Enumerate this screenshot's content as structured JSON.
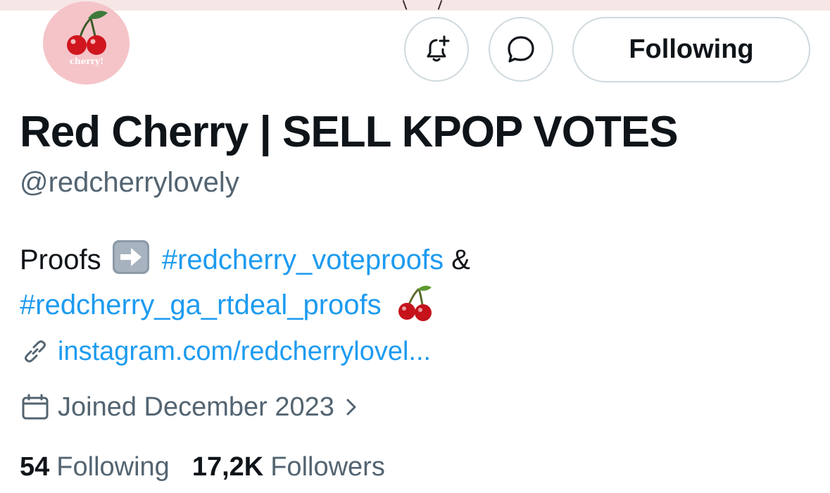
{
  "profile": {
    "display_name": "Red Cherry | SELL KPOP VOTES",
    "handle": "@redcherrylovely",
    "avatar_text": "cherry!"
  },
  "actions": {
    "notify_icon": "bell-plus-icon",
    "message_icon": "message-bubble-icon",
    "follow_label": "Following"
  },
  "bio": {
    "prefix": "Proofs",
    "arrow_emoji": "right-arrow-emoji",
    "tag1": "#redcherry_voteproofs",
    "joiner": "&",
    "tag2": "#redcherry_ga_rtdeal_proofs",
    "end_emoji": "cherry-emoji"
  },
  "meta": {
    "link_icon": "link-icon",
    "link": "instagram.com/redcherrylovel...",
    "calendar_icon": "calendar-icon",
    "joined": "Joined December 2023",
    "chevron_icon": "chevron-right-icon"
  },
  "stats": {
    "following_count": "54",
    "following_label": "Following",
    "followers_count": "17,2K",
    "followers_label": "Followers"
  },
  "colors": {
    "link_blue": "#1d9bf0",
    "secondary_text": "#536471",
    "border": "#cfd9de",
    "avatar_bg": "#f4c4c8",
    "cherry_red": "#d0161e"
  }
}
